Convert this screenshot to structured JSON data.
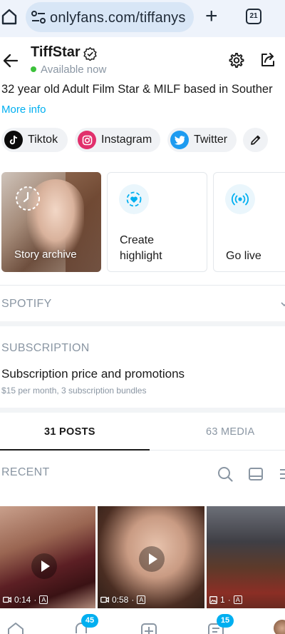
{
  "browser": {
    "url": "onlyfans.com/tiffanys",
    "tab_count": "21"
  },
  "profile": {
    "name": "TiffStar",
    "status": "Available now",
    "bio": "32 year old Adult Film Star & MILF based in Souther",
    "more_info": "More info"
  },
  "socials": [
    {
      "label": "Tiktok",
      "icon": "tiktok-icon",
      "color": "#0b0b0b"
    },
    {
      "label": "Instagram",
      "icon": "instagram-icon",
      "color": "#e1306c"
    },
    {
      "label": "Twitter",
      "icon": "twitter-icon",
      "color": "#1d9bf0"
    }
  ],
  "highlights": {
    "story_archive": "Story archive",
    "create_highlight_line1": "Create",
    "create_highlight_line2": "highlight",
    "go_live": "Go live"
  },
  "sections": {
    "spotify": "SPOTIFY",
    "subscription": "SUBSCRIPTION",
    "subscription_title": "Subscription price and promotions",
    "subscription_detail": "$15 per month, 3 subscription bundles"
  },
  "tabs": {
    "posts": "31 POSTS",
    "media": "63 MEDIA"
  },
  "recent": {
    "title": "RECENT"
  },
  "media": [
    {
      "type": "video",
      "duration": "0:14",
      "flag": "A"
    },
    {
      "type": "video",
      "duration": "0:58",
      "flag": "A"
    },
    {
      "type": "image",
      "count": "1",
      "flag": "A"
    }
  ],
  "bottom_nav": {
    "notifications_badge": "45",
    "messages_badge": "15"
  },
  "colors": {
    "accent": "#00aff0",
    "online": "#3cc13b",
    "muted": "#8a96a3"
  }
}
